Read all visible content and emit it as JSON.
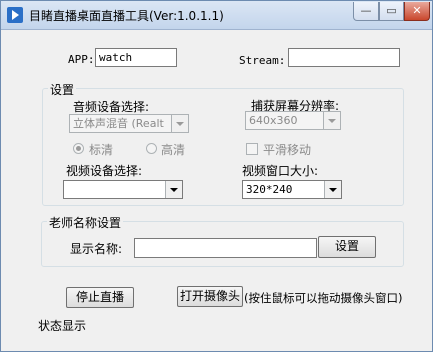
{
  "window": {
    "title": "目睹直播桌面直播工具(Ver:1.0.1.1)",
    "min_glyph": "—",
    "max_glyph": "▭",
    "close_glyph": "✕"
  },
  "top": {
    "app_label": "APP:",
    "app_value": "watch",
    "stream_label": "Stream:",
    "stream_value": ""
  },
  "settings": {
    "group_title": "设置",
    "audio_device_label": "音频设备选择:",
    "audio_device_value": "立体声混音 (Realt",
    "resolution_label": "捕获屏幕分辨率:",
    "resolution_value": "640x360",
    "quality_standard": "标清",
    "quality_high": "高清",
    "quality_selected": "标清",
    "smooth_move_label": "平滑移动",
    "smooth_move_checked": false,
    "video_device_label": "视频设备选择:",
    "video_device_value": "",
    "video_window_label": "视频窗口大小:",
    "video_window_value": "320*240"
  },
  "teacher": {
    "group_title": "老师名称设置",
    "display_name_label": "显示名称:",
    "display_name_value": "",
    "set_button": "设置"
  },
  "actions": {
    "stop_live": "停止直播",
    "open_camera": "打开摄像头",
    "camera_hint": "(按住鼠标可以拖动摄像头窗口)"
  },
  "status": {
    "text": "状态显示"
  }
}
